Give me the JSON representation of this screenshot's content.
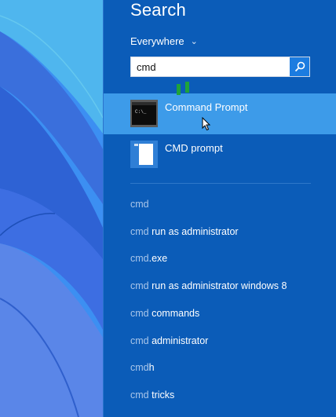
{
  "search": {
    "title": "Search",
    "scope_label": "Everywhere",
    "query": "cmd"
  },
  "results": [
    {
      "label": "Command Prompt",
      "icon": "console-app-icon",
      "selected": true
    },
    {
      "label": "CMD prompt",
      "icon": "white-document-tile-icon",
      "selected": false
    }
  ],
  "suggestions": [
    {
      "query": "cmd",
      "rest": ""
    },
    {
      "query": "cmd",
      "rest": " run as administrator"
    },
    {
      "query": "cmd",
      "rest": ".exe"
    },
    {
      "query": "cmd",
      "rest": " run as administrator windows 8"
    },
    {
      "query": "cmd",
      "rest": " commands"
    },
    {
      "query": "cmd",
      "rest": " administrator"
    },
    {
      "query": "cmd",
      "rest": "h"
    },
    {
      "query": "cmd",
      "rest": " tricks"
    }
  ],
  "colors": {
    "pane_bg": "#0b5cb8",
    "selected_bg": "#3d9be9",
    "query_highlight": "#a9c6ea"
  }
}
